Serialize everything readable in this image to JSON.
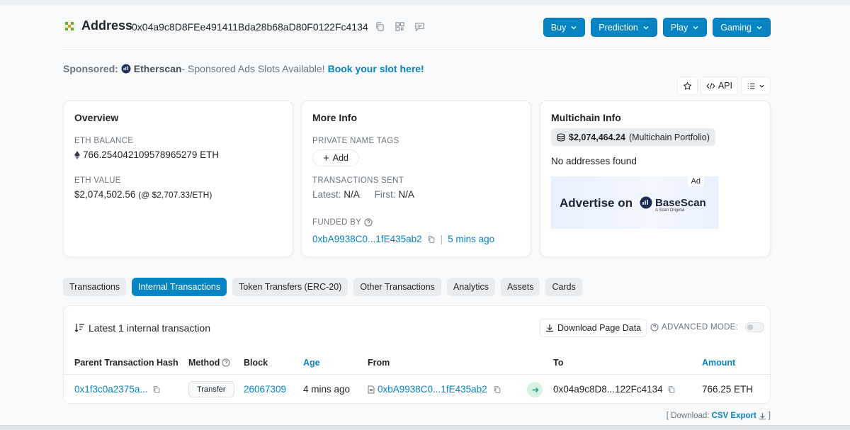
{
  "header": {
    "title": "Address",
    "address": "0x04a9c8D8FEe491411Bda28b68aD80F0122Fc4134",
    "nav_buttons": [
      "Buy",
      "Prediction",
      "Play",
      "Gaming"
    ]
  },
  "sponsored": {
    "label": "Sponsored:",
    "brand": "Etherscan",
    "text": " - Sponsored Ads Slots Available!",
    "cta": "Book your slot here!"
  },
  "toolbar": {
    "api_label": "API"
  },
  "overview": {
    "title": "Overview",
    "eth_balance_label": "ETH BALANCE",
    "eth_balance": "766.254042109578965279 ETH",
    "eth_value_label": "ETH VALUE",
    "eth_value": "$2,074,502.56",
    "eth_price": "(@ $2,707.33/ETH)"
  },
  "more_info": {
    "title": "More Info",
    "private_tags_label": "PRIVATE NAME TAGS",
    "add_label": "Add",
    "tx_sent_label": "TRANSACTIONS SENT",
    "latest_label": "Latest:",
    "latest_value": "N/A",
    "first_label": "First:",
    "first_value": "N/A",
    "funded_by_label": "FUNDED BY",
    "funded_by_address": "0xbA9938C0...1fE435ab2",
    "funded_by_time": "5 mins ago"
  },
  "multichain": {
    "title": "Multichain Info",
    "portfolio_value": "$2,074,464.24",
    "portfolio_label": "(Multichain Portfolio)",
    "no_addresses": "No addresses found",
    "ad_badge": "Ad",
    "ad_text": "Advertise on",
    "ad_brand": "BaseScan",
    "ad_sub": "A Scan Original"
  },
  "tabs": [
    {
      "label": "Transactions",
      "active": false
    },
    {
      "label": "Internal Transactions",
      "active": true
    },
    {
      "label": "Token Transfers (ERC-20)",
      "active": false
    },
    {
      "label": "Other Transactions",
      "active": false
    },
    {
      "label": "Analytics",
      "active": false
    },
    {
      "label": "Assets",
      "active": false
    },
    {
      "label": "Cards",
      "active": false
    }
  ],
  "transactions": {
    "title": "Latest 1 internal transaction",
    "download_label": "Download Page Data",
    "advanced_label": "ADVANCED MODE:",
    "columns": {
      "hash": "Parent Transaction Hash",
      "method": "Method",
      "block": "Block",
      "age": "Age",
      "from": "From",
      "to": "To",
      "amount": "Amount"
    },
    "rows": [
      {
        "hash": "0x1f3c0a2375a...",
        "method": "Transfer",
        "block": "26067309",
        "age": "4 mins ago",
        "from": "0xbA9938C0...1fE435ab2",
        "to": "0x04a9c8D8...122Fc4134",
        "amount": "766.25 ETH"
      }
    ],
    "csv_prefix": "[ Download:",
    "csv_label": "CSV Export",
    "csv_suffix": "]"
  },
  "colors": {
    "accent": "#0784c3",
    "text": "#212529",
    "muted": "#6c757d",
    "border": "#e9ecef",
    "success_bg": "#d7f2e1"
  }
}
